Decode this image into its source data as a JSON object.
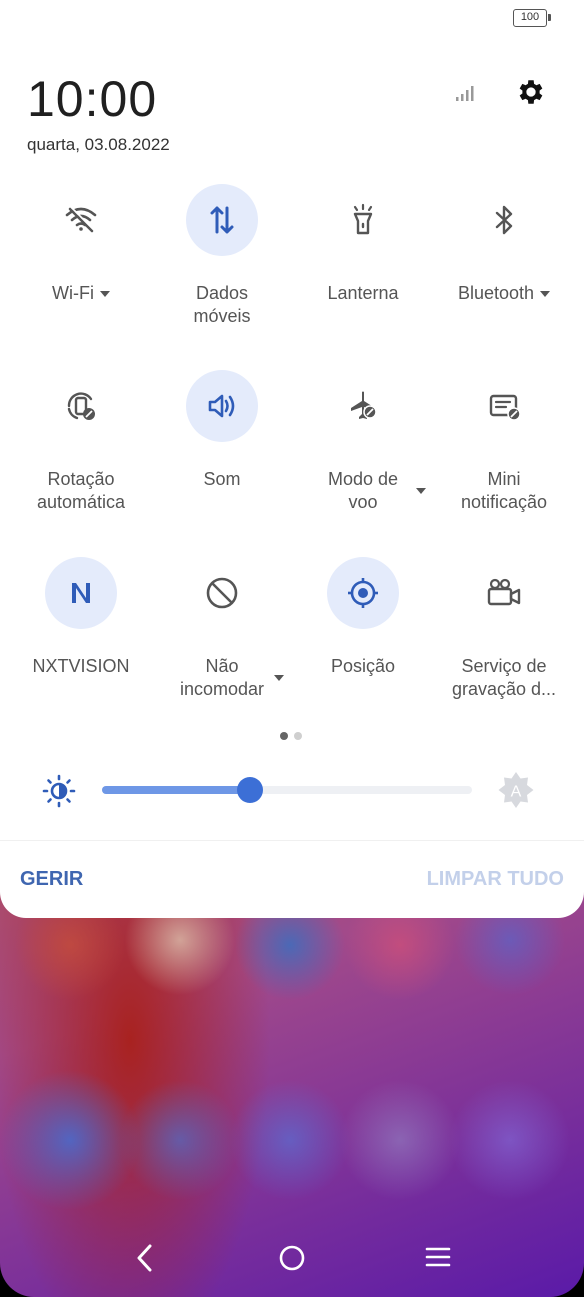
{
  "status_bar": {
    "battery_level": "100"
  },
  "header": {
    "time": "10:00",
    "date": "quarta, 03.08.2022",
    "signal_icon": "signal-bars-icon",
    "settings_icon": "gear-icon"
  },
  "tiles": [
    {
      "label": "Wi-Fi",
      "icon": "wifi-off-icon",
      "active": false,
      "has_menu": true
    },
    {
      "label": "Dados\nmóveis",
      "label_line1": "Dados",
      "label_line2": "móveis",
      "icon": "mobile-data-icon",
      "active": true,
      "has_menu": false
    },
    {
      "label": "Lanterna",
      "icon": "flashlight-icon",
      "active": false,
      "has_menu": false
    },
    {
      "label": "Bluetooth",
      "icon": "bluetooth-icon",
      "active": false,
      "has_menu": true
    },
    {
      "label_line1": "Rotação",
      "label_line2": "automática",
      "icon": "auto-rotate-icon",
      "active": false,
      "has_menu": false
    },
    {
      "label": "Som",
      "icon": "sound-icon",
      "active": true,
      "has_menu": false
    },
    {
      "label_line1": "Modo de",
      "label_line2": "voo",
      "icon": "airplane-icon",
      "active": false,
      "has_menu": true
    },
    {
      "label_line1": "Mini",
      "label_line2": "notificação",
      "icon": "mini-notification-icon",
      "active": false,
      "has_menu": false
    },
    {
      "label": "NXTVISION",
      "icon": "nxtvision-icon",
      "active": true,
      "has_menu": false
    },
    {
      "label_line1": "Não",
      "label_line2": "incomodar",
      "icon": "do-not-disturb-icon",
      "active": false,
      "has_menu": true
    },
    {
      "label": "Posição",
      "icon": "location-icon",
      "active": true,
      "has_menu": false
    },
    {
      "label_line1": "Serviço de",
      "label_line2": "gravação d...",
      "icon": "screen-record-icon",
      "active": false,
      "has_menu": false
    }
  ],
  "page_indicator": {
    "current": 1,
    "total": 2
  },
  "brightness": {
    "level": 0.4,
    "icon": "brightness-icon",
    "auto_icon": "auto-brightness-icon"
  },
  "actions": {
    "manage_label": "GERIR",
    "clear_all_label": "LIMPAR TUDO"
  },
  "nav": {
    "back_icon": "back-icon",
    "home_icon": "home-icon",
    "menu_icon": "menu-icon"
  },
  "colors": {
    "accent": "#3c6fd6",
    "active_bg": "#e4ebfb",
    "manage": "#3f66b0",
    "clear_all": "#c3d0ea"
  }
}
